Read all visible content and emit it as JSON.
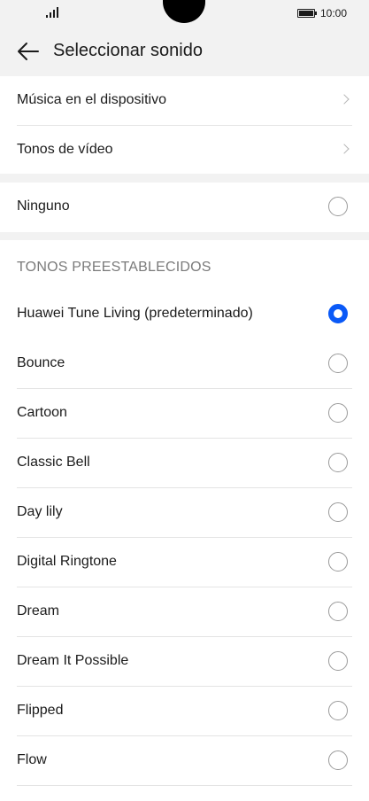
{
  "status_bar": {
    "time": "10:00"
  },
  "header": {
    "title": "Seleccionar sonido"
  },
  "sources": [
    {
      "label": "Música en el dispositivo"
    },
    {
      "label": "Tonos de vídeo"
    }
  ],
  "none_option": {
    "label": "Ninguno",
    "selected": false
  },
  "presets": {
    "heading": "TONOS PREESTABLECIDOS",
    "items": [
      {
        "label": "Huawei Tune Living (predeterminado)",
        "selected": true
      },
      {
        "label": "Bounce",
        "selected": false
      },
      {
        "label": "Cartoon",
        "selected": false
      },
      {
        "label": "Classic Bell",
        "selected": false
      },
      {
        "label": "Day lily",
        "selected": false
      },
      {
        "label": "Digital Ringtone",
        "selected": false
      },
      {
        "label": "Dream",
        "selected": false
      },
      {
        "label": "Dream It Possible",
        "selected": false
      },
      {
        "label": "Flipped",
        "selected": false
      },
      {
        "label": "Flow",
        "selected": false
      }
    ]
  },
  "colors": {
    "accent": "#0a59f7",
    "background": "#f2f2f2",
    "card": "#ffffff"
  },
  "icons": {
    "back": "arrow-left-icon",
    "chevron": "chevron-right-icon",
    "signal": "signal-icon",
    "battery": "battery-icon"
  }
}
